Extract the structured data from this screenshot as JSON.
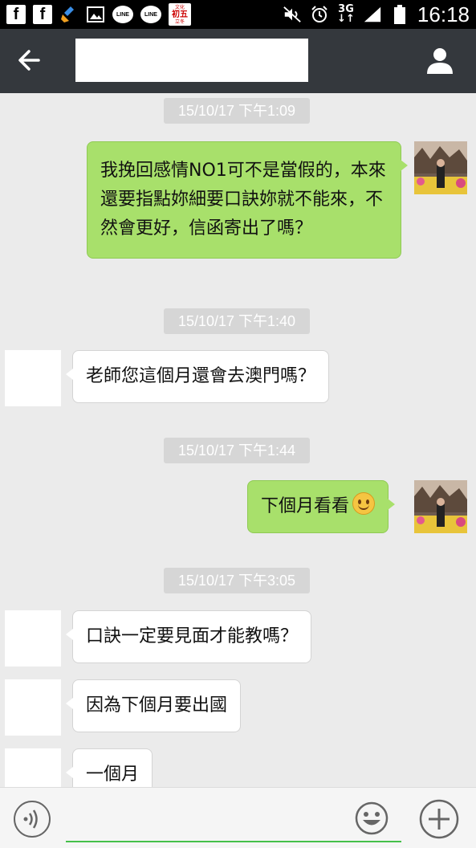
{
  "status_bar": {
    "time": "16:18",
    "network": "3G",
    "network_sub": "↓↑",
    "calendar_top": "文化",
    "calendar_main": "初五",
    "calendar_bottom": "立冬",
    "line_label": "LINE",
    "facebook_label": "f"
  },
  "header": {
    "title": ""
  },
  "messages": [
    {
      "type": "timestamp",
      "text": "15/10/17 下午1:09"
    },
    {
      "type": "sent",
      "text": "我挽回感情NO1可不是當假的，本來還要指點妳細要口訣妳就不能來，不然會更好，信函寄出了嗎？"
    },
    {
      "type": "timestamp",
      "text": "15/10/17 下午1:40"
    },
    {
      "type": "received",
      "text": "老師您這個月還會去澳門嗎？"
    },
    {
      "type": "timestamp",
      "text": "15/10/17 下午1:44"
    },
    {
      "type": "sent",
      "text": "下個月看看",
      "emoji": "smiley-emoji"
    },
    {
      "type": "timestamp",
      "text": "15/10/17 下午3:05"
    },
    {
      "type": "received",
      "text": "口訣一定要見面才能教嗎？"
    },
    {
      "type": "received",
      "text": "因為下個月要出國"
    },
    {
      "type": "received",
      "text": "一個月"
    }
  ],
  "input": {
    "value": ""
  },
  "colors": {
    "sent_bubble": "#a8e06b",
    "received_bubble": "#ffffff",
    "header_bg": "#34383d",
    "chat_bg": "#ebebeb",
    "timestamp_bg": "#d6d6d6",
    "input_accent": "#45c04a"
  },
  "icons": [
    "back-arrow-icon",
    "profile-icon",
    "voice-icon",
    "emoji-icon",
    "plus-icon",
    "facebook-icon",
    "cleaner-icon",
    "gallery-icon",
    "line-icon",
    "calendar-icon",
    "mute-icon",
    "alarm-icon",
    "signal-icon",
    "battery-icon"
  ]
}
